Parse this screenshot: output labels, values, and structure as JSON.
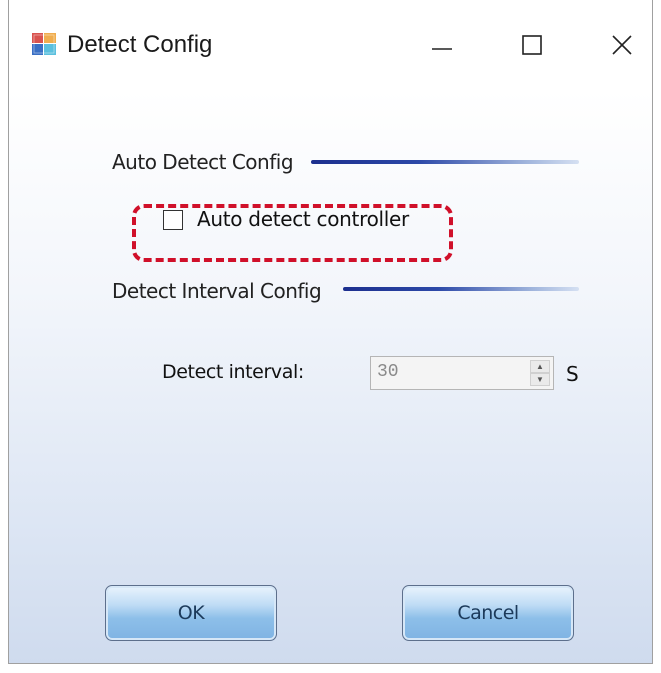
{
  "window": {
    "title": "Detect Config",
    "icon": "app-icon"
  },
  "titlebar": {
    "minimize_icon": "minimize-icon",
    "maximize_icon": "maximize-icon",
    "close_icon": "close-icon"
  },
  "auto_detect": {
    "section_label": "Auto Detect Config",
    "checkbox_label": "Auto detect controller",
    "checked": false
  },
  "detect_interval": {
    "section_label": "Detect Interval Config",
    "field_label": "Detect interval:",
    "value": "30",
    "unit": "S",
    "enabled": false
  },
  "buttons": {
    "ok_label": "OK",
    "cancel_label": "Cancel"
  },
  "colors": {
    "highlight": "#d0102a",
    "section_line": "#1c2f8e",
    "button_fill": "#8dbfe9"
  }
}
